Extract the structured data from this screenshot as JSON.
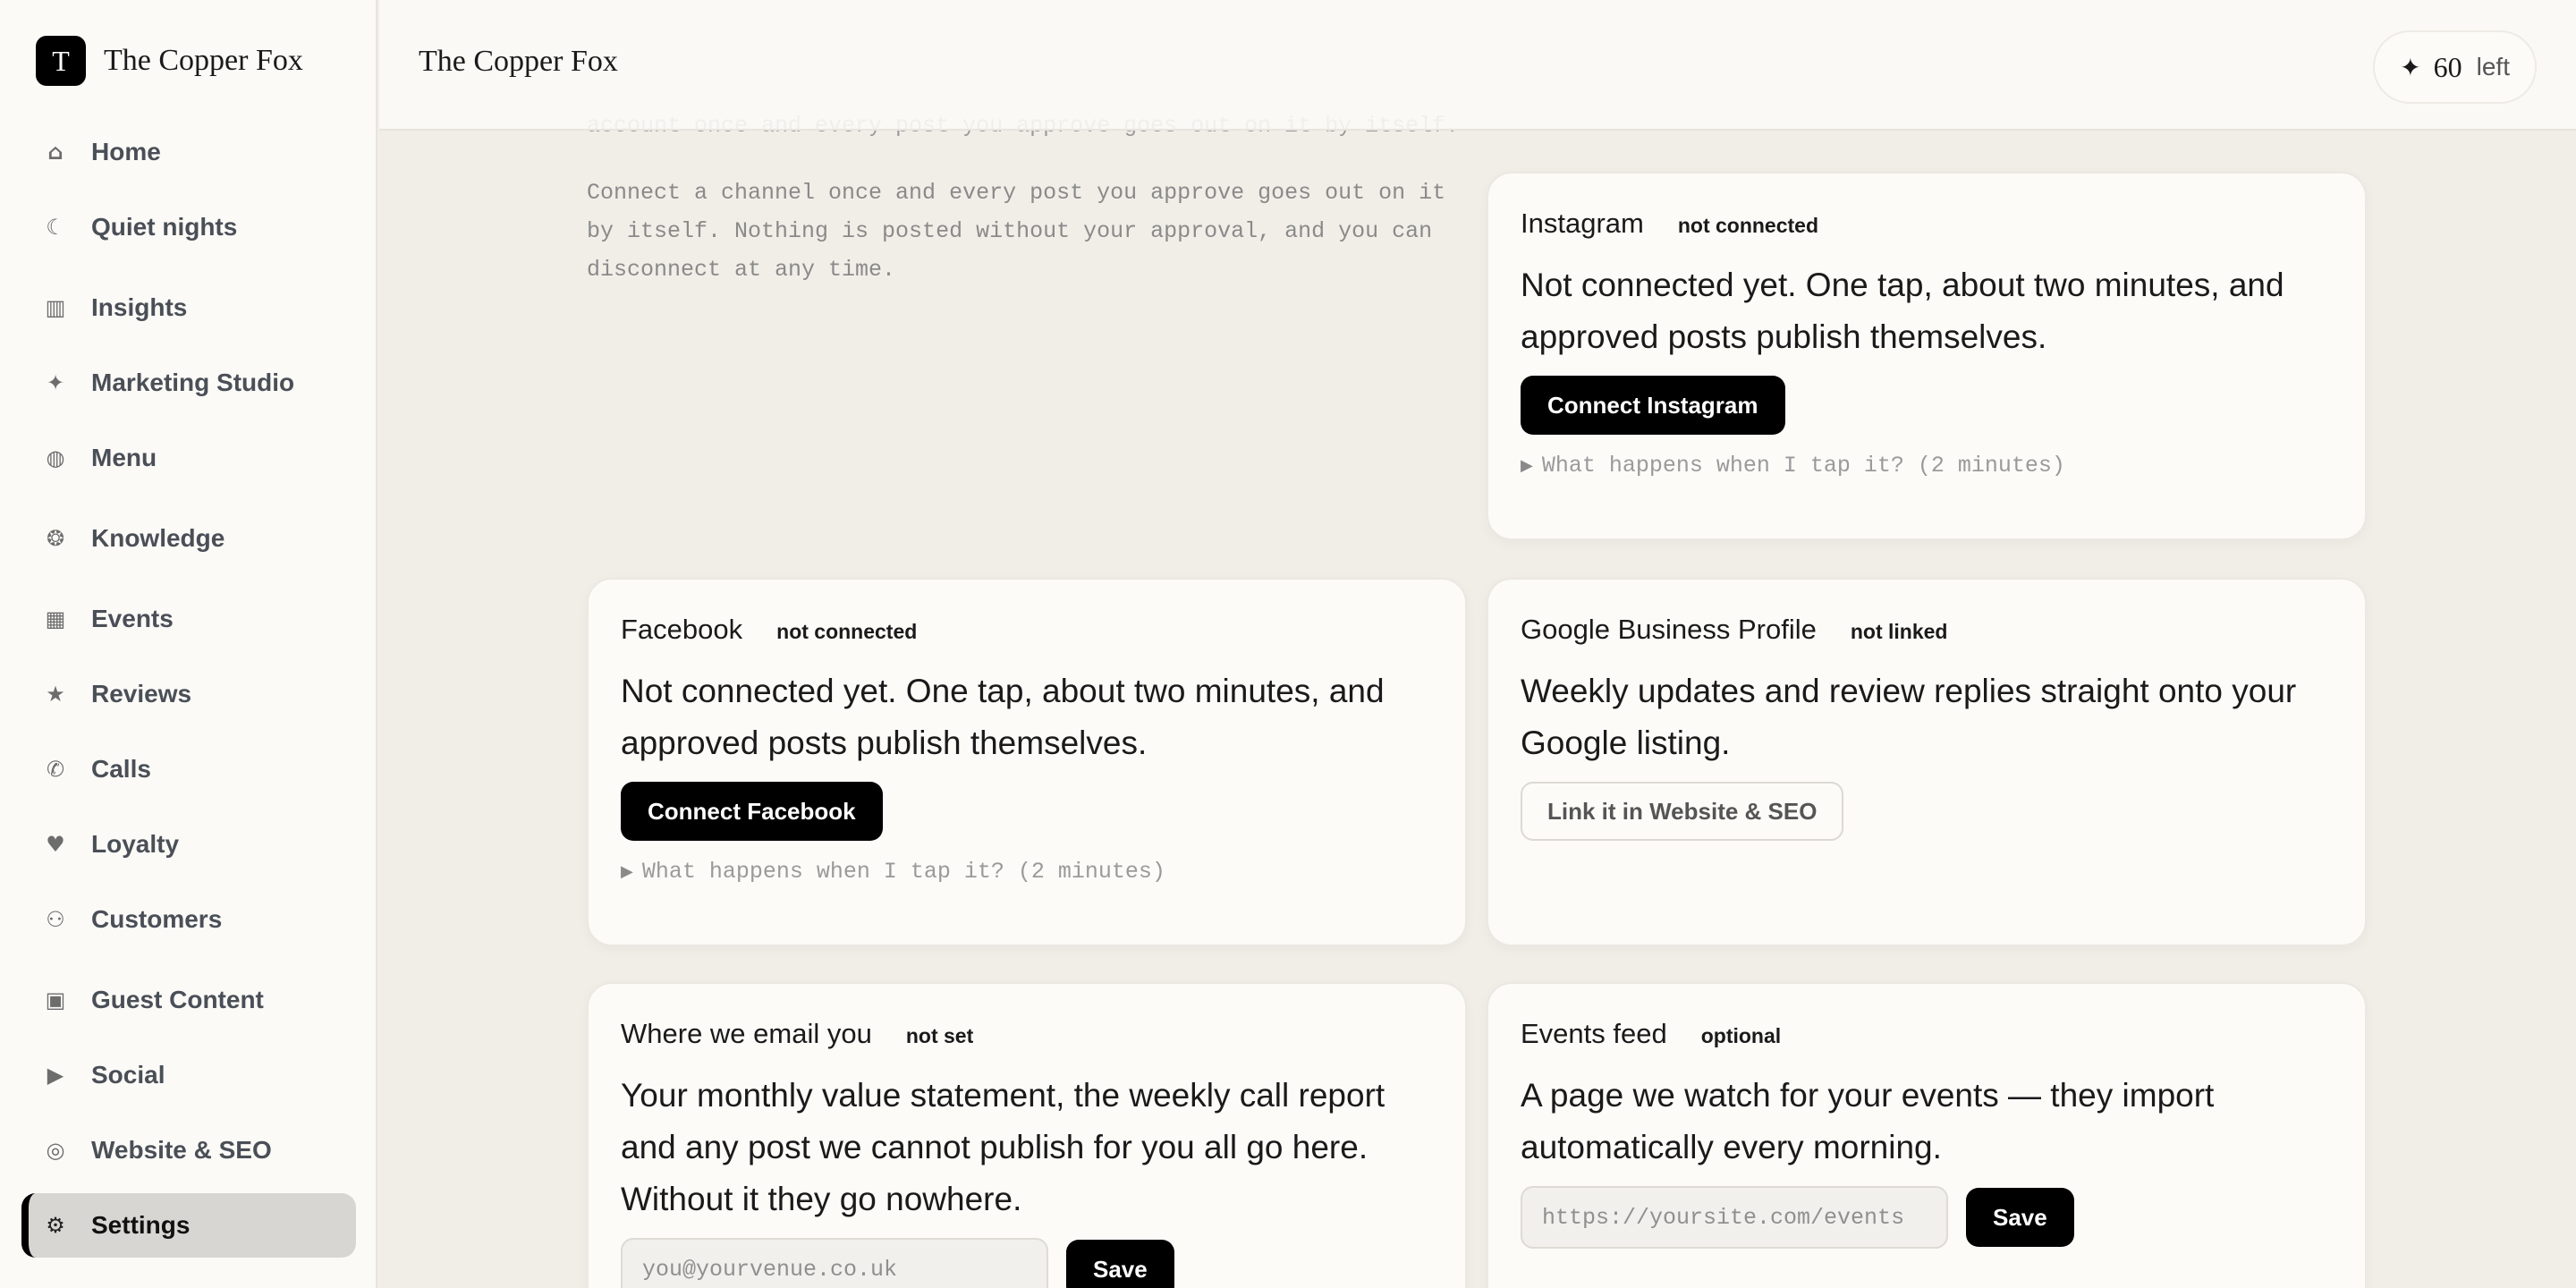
{
  "app": {
    "brand_initial": "T",
    "brand_name": "The Copper Fox"
  },
  "sidebar": {
    "items": [
      {
        "label": "Home",
        "icon": "⌂",
        "icon_name": "home-icon"
      },
      {
        "label": "Quiet nights",
        "icon": "☾",
        "icon_name": "moon-icon"
      },
      {
        "label": "Insights",
        "icon": "▥",
        "icon_name": "bar-chart-icon"
      },
      {
        "label": "Marketing Studio",
        "icon": "✦",
        "icon_name": "sparkle-icon"
      },
      {
        "label": "Menu",
        "icon": "◍",
        "icon_name": "plate-icon"
      },
      {
        "label": "Knowledge",
        "icon": "❂",
        "icon_name": "brain-icon"
      },
      {
        "label": "Events",
        "icon": "▦",
        "icon_name": "calendar-icon"
      },
      {
        "label": "Reviews",
        "icon": "★",
        "icon_name": "star-icon"
      },
      {
        "label": "Calls",
        "icon": "✆",
        "icon_name": "phone-icon"
      },
      {
        "label": "Loyalty",
        "icon": "♥",
        "icon_name": "heart-icon"
      },
      {
        "label": "Customers",
        "icon": "⚇",
        "icon_name": "people-icon"
      },
      {
        "label": "Guest Content",
        "icon": "▣",
        "icon_name": "clapper-icon"
      },
      {
        "label": "Social",
        "icon": "▶",
        "icon_name": "play-icon"
      },
      {
        "label": "Website & SEO",
        "icon": "◎",
        "icon_name": "globe-icon"
      },
      {
        "label": "Settings",
        "icon": "⚙",
        "icon_name": "gear-icon"
      }
    ],
    "active_index": 14
  },
  "topbar": {
    "title": "The Copper Fox",
    "credits_icon": "✦",
    "credits_count": "60",
    "credits_suffix": "left"
  },
  "main": {
    "ghost_text": "account once and every post you approve goes out on it by itself.",
    "intro_text": "Connect a channel once and every post you approve goes out on it by itself. Nothing is posted without your approval, and you can disconnect at any time.",
    "cards": {
      "instagram": {
        "title": "Instagram",
        "badge": "not connected",
        "description": "Not connected yet. One tap, about two minutes, and approved posts publish themselves.",
        "button": "Connect Instagram",
        "details": "What happens when I tap it? (2 minutes)"
      },
      "facebook": {
        "title": "Facebook",
        "badge": "not connected",
        "description": "Not connected yet. One tap, about two minutes, and approved posts publish themselves.",
        "button": "Connect Facebook",
        "details": "What happens when I tap it? (2 minutes)"
      },
      "google": {
        "title": "Google Business Profile",
        "badge": "not linked",
        "description": "Weekly updates and review replies straight onto your Google listing.",
        "button": "Link it in Website & SEO"
      },
      "email": {
        "title": "Where we email you",
        "badge": "not set",
        "description": "Your monthly value statement, the weekly call report and any post we cannot publish for you all go here. Without it they go nowhere.",
        "placeholder": "you@yourvenue.co.uk",
        "button": "Save"
      },
      "events": {
        "title": "Events feed",
        "badge": "optional",
        "description": "A page we watch for your events — they import automatically every morning.",
        "placeholder": "https://yoursite.com/events",
        "button": "Save"
      }
    }
  },
  "colors": {
    "background": "#f1eee8",
    "sidebar": "#fbfaf7",
    "card": "#fcfbf8",
    "primary_button": "#000000",
    "active_nav": "#d8d6d2"
  }
}
